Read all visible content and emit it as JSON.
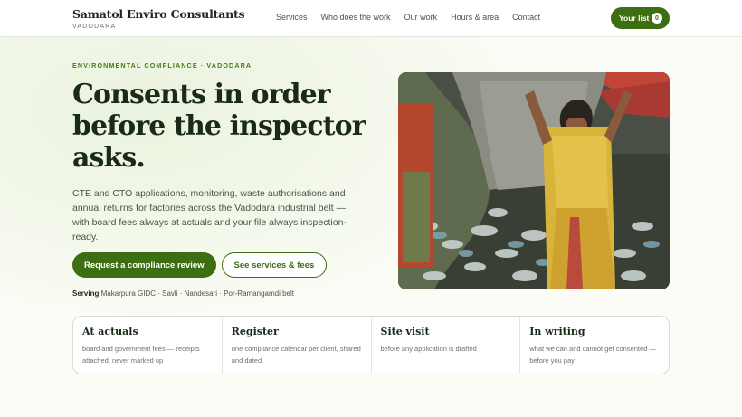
{
  "header": {
    "brand_name": "Samatol Enviro Consultants",
    "brand_location": "VADODARA",
    "nav": [
      "Services",
      "Who does the work",
      "Our work",
      "Hours & area",
      "Contact"
    ],
    "list_button": {
      "label": "Your list",
      "count": "0"
    }
  },
  "hero": {
    "eyebrow": "ENVIRONMENTAL COMPLIANCE · VADODARA",
    "title_line1": "Consents in order",
    "title_line2": "before the inspector",
    "title_line3": "asks.",
    "lede": "CTE and CTO applications, monitoring, waste authorisations and annual returns for factories across the Vadodara industrial belt — with board fees always at actuals and your file always inspection-ready.",
    "primary_cta": "Request a compliance review",
    "secondary_cta": "See services & fees",
    "serving_label": "Serving",
    "serving_areas": "Makarpura GIDC · Savli · Nandesari · Por-Ramangamdi belt"
  },
  "features": [
    {
      "title": "At actuals",
      "text": "board and government fees — receipts attached, never marked up"
    },
    {
      "title": "Register",
      "text": "one compliance calendar per client, shared and dated"
    },
    {
      "title": "Site visit",
      "text": "before any application is drafted"
    },
    {
      "title": "In writing",
      "text": "what we can and cannot get consented — before you pay"
    }
  ],
  "colors": {
    "accent": "#3c6e12",
    "eyebrow": "#4a7a1f",
    "background": "#fbfcf6"
  }
}
